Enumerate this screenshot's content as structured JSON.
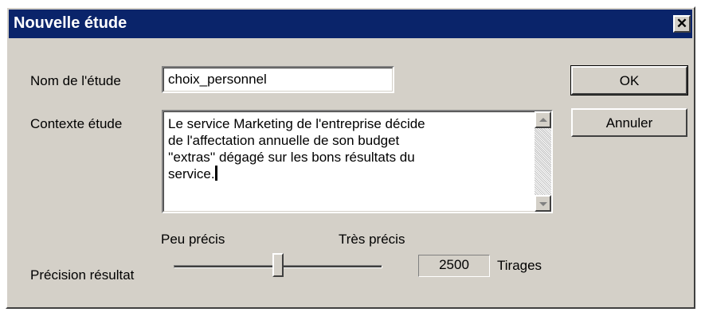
{
  "window": {
    "title": "Nouvelle étude",
    "close_glyph": "✕"
  },
  "form": {
    "study_name_label": "Nom de l'étude",
    "study_name_value": "choix_personnel",
    "context_label": "Contexte étude",
    "context_value": "Le service Marketing de l'entreprise décide\nde l'affectation annuelle de son budget\n''extras'' dégagé sur les bons résultats du\nservice."
  },
  "buttons": {
    "ok_label": "OK",
    "cancel_label": "Annuler"
  },
  "precision": {
    "label": "Précision résultat",
    "min_label": "Peu précis",
    "max_label": "Très précis",
    "slider_level": 0.5,
    "draws_value": "2500",
    "draws_unit": "Tirages"
  },
  "icons": {
    "close": "close-icon",
    "scroll_up": "scroll-up-icon",
    "scroll_down": "scroll-down-icon"
  },
  "colors": {
    "titlebar": "#0a246a",
    "window_face": "#d4d0c8"
  }
}
